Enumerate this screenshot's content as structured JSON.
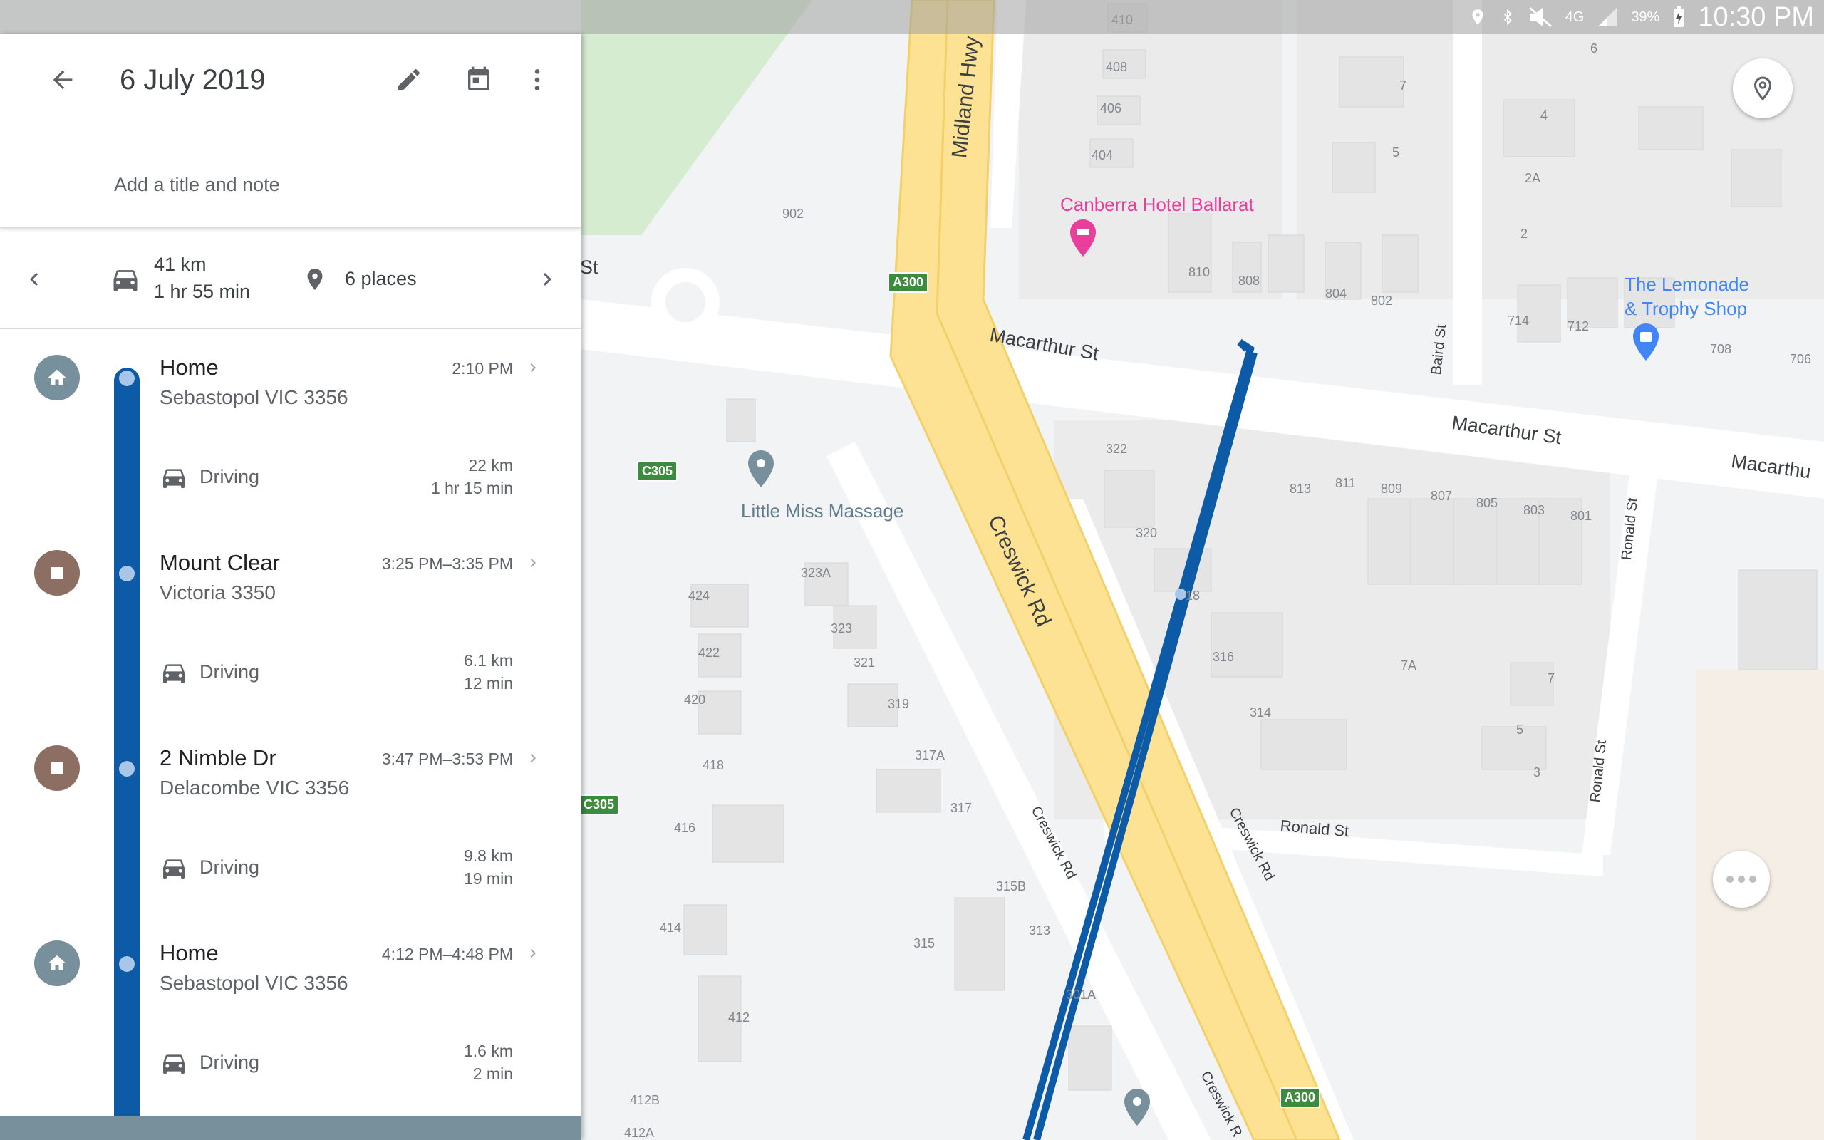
{
  "status_bar": {
    "network": "4G",
    "battery": "39%",
    "time": "10:30 PM"
  },
  "panel": {
    "date": "6 July 2019",
    "note_placeholder": "Add a title and note",
    "summary": {
      "distance": "41 km",
      "duration": "1 hr 55 min",
      "places": "6 places"
    }
  },
  "timeline": {
    "stops": [
      {
        "name": "Home",
        "address": "Sebastopol VIC 3356",
        "time": "2:10 PM",
        "icon": "home-icon",
        "color": "#78909c"
      },
      {
        "name": "Mount Clear",
        "address": "Victoria 3350",
        "time": "3:25 PM–3:35 PM",
        "icon": "stop-square-icon",
        "color": "#8d6e63"
      },
      {
        "name": "2 Nimble Dr",
        "address": "Delacombe VIC 3356",
        "time": "3:47 PM–3:53 PM",
        "icon": "stop-square-icon",
        "color": "#8d6e63"
      },
      {
        "name": "Home",
        "address": "Sebastopol VIC 3356",
        "time": "4:12 PM–4:48 PM",
        "icon": "home-icon",
        "color": "#78909c"
      }
    ],
    "drives": [
      {
        "label": "Driving",
        "distance": "22 km",
        "duration": "1 hr 15 min"
      },
      {
        "label": "Driving",
        "distance": "6.1 km",
        "duration": "12 min"
      },
      {
        "label": "Driving",
        "distance": "9.8 km",
        "duration": "19 min"
      },
      {
        "label": "Driving",
        "distance": "1.6 km",
        "duration": "2 min"
      }
    ]
  },
  "map": {
    "streets": [
      "Midland Hwy",
      "Macarthur St",
      "Macarthur St",
      "Macarthu",
      "Creswick Rd",
      "Creswick Rd",
      "Creswick Rd",
      "Creswick R",
      "Ronald St",
      "Ronald St",
      "Ronald St",
      "Baird St",
      "St"
    ],
    "pois": [
      "Canberra Hotel Ballarat",
      "The Lemonade",
      "& Trophy Shop",
      "Little Miss Massage"
    ],
    "shields": [
      "A300",
      "A300",
      "C305",
      "C305"
    ],
    "numbers": [
      "410",
      "408",
      "406",
      "404",
      "902",
      "810",
      "808",
      "804",
      "802",
      "714",
      "712",
      "708",
      "706",
      "6",
      "7",
      "5",
      "4",
      "2A",
      "2",
      "322",
      "320",
      "813",
      "811",
      "809",
      "807",
      "805",
      "803",
      "801",
      "323A",
      "424",
      "323",
      "422",
      "321",
      "420",
      "319",
      "418",
      "317A",
      "416",
      "317",
      "316",
      "314",
      "7A",
      "7",
      "5",
      "3",
      "315B",
      "315",
      "313",
      "414",
      "412",
      "301A",
      "412B",
      "412A",
      "18"
    ]
  }
}
